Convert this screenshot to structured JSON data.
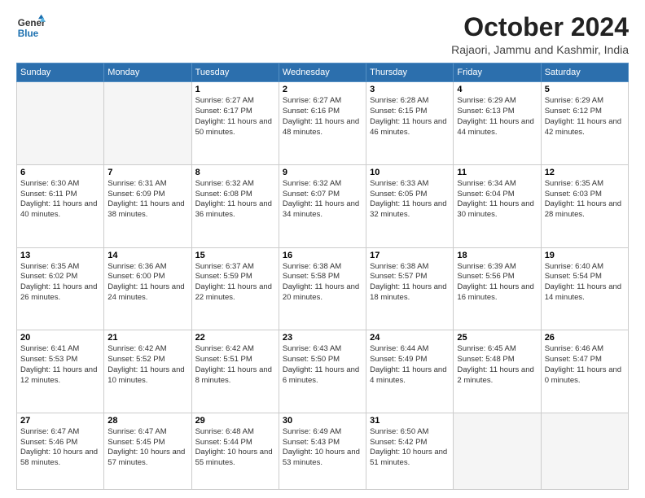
{
  "logo": {
    "line1": "General",
    "line2": "Blue"
  },
  "header": {
    "title": "October 2024",
    "location": "Rajaori, Jammu and Kashmir, India"
  },
  "days_of_week": [
    "Sunday",
    "Monday",
    "Tuesday",
    "Wednesday",
    "Thursday",
    "Friday",
    "Saturday"
  ],
  "weeks": [
    [
      {
        "day": "",
        "text": ""
      },
      {
        "day": "",
        "text": ""
      },
      {
        "day": "1",
        "text": "Sunrise: 6:27 AM\nSunset: 6:17 PM\nDaylight: 11 hours and 50 minutes."
      },
      {
        "day": "2",
        "text": "Sunrise: 6:27 AM\nSunset: 6:16 PM\nDaylight: 11 hours and 48 minutes."
      },
      {
        "day": "3",
        "text": "Sunrise: 6:28 AM\nSunset: 6:15 PM\nDaylight: 11 hours and 46 minutes."
      },
      {
        "day": "4",
        "text": "Sunrise: 6:29 AM\nSunset: 6:13 PM\nDaylight: 11 hours and 44 minutes."
      },
      {
        "day": "5",
        "text": "Sunrise: 6:29 AM\nSunset: 6:12 PM\nDaylight: 11 hours and 42 minutes."
      }
    ],
    [
      {
        "day": "6",
        "text": "Sunrise: 6:30 AM\nSunset: 6:11 PM\nDaylight: 11 hours and 40 minutes."
      },
      {
        "day": "7",
        "text": "Sunrise: 6:31 AM\nSunset: 6:09 PM\nDaylight: 11 hours and 38 minutes."
      },
      {
        "day": "8",
        "text": "Sunrise: 6:32 AM\nSunset: 6:08 PM\nDaylight: 11 hours and 36 minutes."
      },
      {
        "day": "9",
        "text": "Sunrise: 6:32 AM\nSunset: 6:07 PM\nDaylight: 11 hours and 34 minutes."
      },
      {
        "day": "10",
        "text": "Sunrise: 6:33 AM\nSunset: 6:05 PM\nDaylight: 11 hours and 32 minutes."
      },
      {
        "day": "11",
        "text": "Sunrise: 6:34 AM\nSunset: 6:04 PM\nDaylight: 11 hours and 30 minutes."
      },
      {
        "day": "12",
        "text": "Sunrise: 6:35 AM\nSunset: 6:03 PM\nDaylight: 11 hours and 28 minutes."
      }
    ],
    [
      {
        "day": "13",
        "text": "Sunrise: 6:35 AM\nSunset: 6:02 PM\nDaylight: 11 hours and 26 minutes."
      },
      {
        "day": "14",
        "text": "Sunrise: 6:36 AM\nSunset: 6:00 PM\nDaylight: 11 hours and 24 minutes."
      },
      {
        "day": "15",
        "text": "Sunrise: 6:37 AM\nSunset: 5:59 PM\nDaylight: 11 hours and 22 minutes."
      },
      {
        "day": "16",
        "text": "Sunrise: 6:38 AM\nSunset: 5:58 PM\nDaylight: 11 hours and 20 minutes."
      },
      {
        "day": "17",
        "text": "Sunrise: 6:38 AM\nSunset: 5:57 PM\nDaylight: 11 hours and 18 minutes."
      },
      {
        "day": "18",
        "text": "Sunrise: 6:39 AM\nSunset: 5:56 PM\nDaylight: 11 hours and 16 minutes."
      },
      {
        "day": "19",
        "text": "Sunrise: 6:40 AM\nSunset: 5:54 PM\nDaylight: 11 hours and 14 minutes."
      }
    ],
    [
      {
        "day": "20",
        "text": "Sunrise: 6:41 AM\nSunset: 5:53 PM\nDaylight: 11 hours and 12 minutes."
      },
      {
        "day": "21",
        "text": "Sunrise: 6:42 AM\nSunset: 5:52 PM\nDaylight: 11 hours and 10 minutes."
      },
      {
        "day": "22",
        "text": "Sunrise: 6:42 AM\nSunset: 5:51 PM\nDaylight: 11 hours and 8 minutes."
      },
      {
        "day": "23",
        "text": "Sunrise: 6:43 AM\nSunset: 5:50 PM\nDaylight: 11 hours and 6 minutes."
      },
      {
        "day": "24",
        "text": "Sunrise: 6:44 AM\nSunset: 5:49 PM\nDaylight: 11 hours and 4 minutes."
      },
      {
        "day": "25",
        "text": "Sunrise: 6:45 AM\nSunset: 5:48 PM\nDaylight: 11 hours and 2 minutes."
      },
      {
        "day": "26",
        "text": "Sunrise: 6:46 AM\nSunset: 5:47 PM\nDaylight: 11 hours and 0 minutes."
      }
    ],
    [
      {
        "day": "27",
        "text": "Sunrise: 6:47 AM\nSunset: 5:46 PM\nDaylight: 10 hours and 58 minutes."
      },
      {
        "day": "28",
        "text": "Sunrise: 6:47 AM\nSunset: 5:45 PM\nDaylight: 10 hours and 57 minutes."
      },
      {
        "day": "29",
        "text": "Sunrise: 6:48 AM\nSunset: 5:44 PM\nDaylight: 10 hours and 55 minutes."
      },
      {
        "day": "30",
        "text": "Sunrise: 6:49 AM\nSunset: 5:43 PM\nDaylight: 10 hours and 53 minutes."
      },
      {
        "day": "31",
        "text": "Sunrise: 6:50 AM\nSunset: 5:42 PM\nDaylight: 10 hours and 51 minutes."
      },
      {
        "day": "",
        "text": ""
      },
      {
        "day": "",
        "text": ""
      }
    ]
  ]
}
